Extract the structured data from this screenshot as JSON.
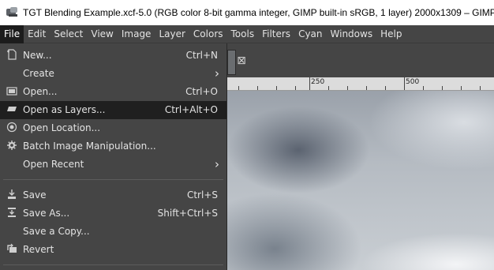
{
  "window": {
    "title": "TGT Blending Example.xcf-5.0 (RGB color 8-bit gamma integer, GIMP built-in sRGB, 1 layer) 2000x1309 – GIMP"
  },
  "menubar": {
    "items": [
      "File",
      "Edit",
      "Select",
      "View",
      "Image",
      "Layer",
      "Colors",
      "Tools",
      "Filters",
      "Cyan",
      "Windows",
      "Help"
    ]
  },
  "file_menu": {
    "items": [
      {
        "label": "New...",
        "shortcut": "Ctrl+N",
        "icon": "new-icon"
      },
      {
        "label": "Create",
        "shortcut": "",
        "icon": "",
        "submenu": true
      },
      {
        "label": "Open...",
        "shortcut": "Ctrl+O",
        "icon": "open-icon"
      },
      {
        "label": "Open as Layers...",
        "shortcut": "Ctrl+Alt+O",
        "icon": "open-as-layers-icon",
        "highlighted": true
      },
      {
        "label": "Open Location...",
        "shortcut": "",
        "icon": "globe-icon"
      },
      {
        "label": "Batch Image Manipulation...",
        "shortcut": "",
        "icon": "gear-icon"
      },
      {
        "label": "Open Recent",
        "shortcut": "",
        "icon": "",
        "submenu": true
      },
      {
        "label": "Save",
        "shortcut": "Ctrl+S",
        "icon": "save-icon"
      },
      {
        "label": "Save As...",
        "shortcut": "Shift+Ctrl+S",
        "icon": "save-as-icon"
      },
      {
        "label": "Save a Copy...",
        "shortcut": "",
        "icon": ""
      },
      {
        "label": "Revert",
        "shortcut": "",
        "icon": "revert-icon"
      }
    ]
  },
  "ruler": {
    "labels": [
      "250",
      "500"
    ]
  },
  "colors": {
    "menu_bg": "#454545",
    "highlight_bg": "#1f1f1f",
    "text": "#e3e3e3",
    "titlebar_bg": "#ffffff"
  }
}
